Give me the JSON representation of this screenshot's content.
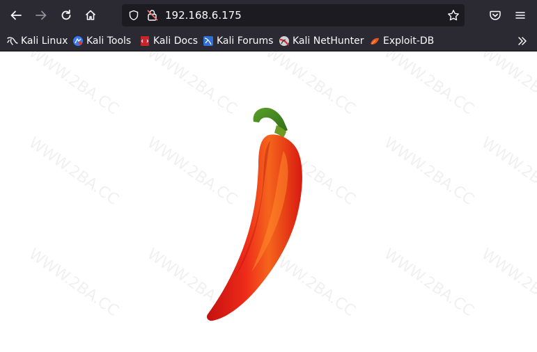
{
  "nav": {
    "back_icon": "arrow-left-icon",
    "forward_icon": "arrow-right-icon",
    "reload_icon": "reload-icon",
    "home_icon": "home-icon"
  },
  "urlbar": {
    "url": "192.168.6.175",
    "shield_icon": "shield-icon",
    "insecure_icon": "insecure-lock-icon",
    "star_icon": "star-icon"
  },
  "toolbar_right": {
    "pocket_icon": "pocket-icon",
    "menu_icon": "hamburger-menu-icon"
  },
  "bookmarks": [
    {
      "label": "Kali Linux",
      "icon": "kali-dragon-icon"
    },
    {
      "label": "Kali Tools",
      "icon": "kali-tools-icon"
    },
    {
      "label": "Kali Docs",
      "icon": "kali-docs-icon"
    },
    {
      "label": "Kali Forums",
      "icon": "kali-forums-icon"
    },
    {
      "label": "Kali NetHunter",
      "icon": "nethunter-icon"
    },
    {
      "label": "Exploit-DB",
      "icon": "exploit-db-icon"
    }
  ],
  "overflow_icon": "chevron-double-right-icon",
  "page": {
    "watermark_text": "WWW.2BA.CC",
    "image_subject": "red-chili-pepper-image"
  },
  "colors": {
    "toolbar_bg": "#2b2a33",
    "urlbar_bg": "#1c1b22",
    "text": "#fbfbfe",
    "page_bg": "#ffffff"
  }
}
